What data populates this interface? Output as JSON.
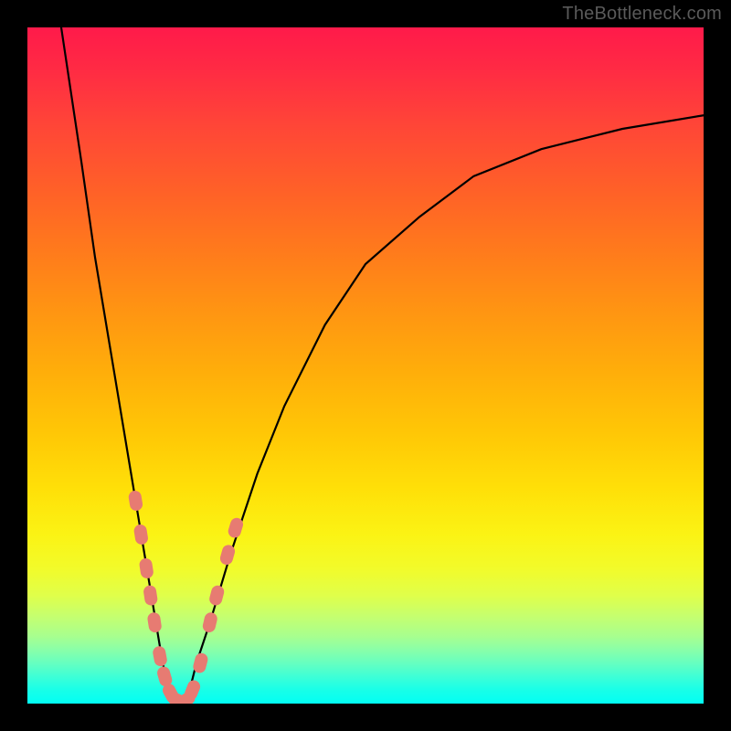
{
  "watermark": "TheBottleneck.com",
  "colors": {
    "frame": "#000000",
    "curve": "#000000",
    "marker": "#e77b72",
    "gradient_top": "#ff1a4a",
    "gradient_bottom": "#02fff4"
  },
  "chart_data": {
    "type": "line",
    "title": "",
    "xlabel": "",
    "ylabel": "",
    "xlim": [
      0,
      100
    ],
    "ylim": [
      0,
      100
    ],
    "grid": false,
    "legend": false,
    "series": [
      {
        "name": "bottleneck-curve",
        "x": [
          5,
          8,
          10,
          12,
          14,
          16,
          17,
          18,
          19,
          20,
          21,
          22,
          23,
          24,
          25,
          27,
          30,
          34,
          38,
          44,
          50,
          58,
          66,
          76,
          88,
          100
        ],
        "y": [
          100,
          80,
          66,
          54,
          42,
          30,
          24,
          18,
          12,
          6,
          2,
          0,
          0,
          2,
          6,
          12,
          22,
          34,
          44,
          56,
          65,
          72,
          78,
          82,
          85,
          87
        ]
      }
    ],
    "markers": {
      "name": "highlighted-points",
      "points": [
        {
          "x": 16.0,
          "y": 30
        },
        {
          "x": 16.8,
          "y": 25
        },
        {
          "x": 17.6,
          "y": 20
        },
        {
          "x": 18.2,
          "y": 16
        },
        {
          "x": 18.8,
          "y": 12
        },
        {
          "x": 19.6,
          "y": 7
        },
        {
          "x": 20.3,
          "y": 4
        },
        {
          "x": 21.2,
          "y": 1.5
        },
        {
          "x": 22.2,
          "y": 0.5
        },
        {
          "x": 23.4,
          "y": 0.5
        },
        {
          "x": 24.4,
          "y": 2
        },
        {
          "x": 25.6,
          "y": 6
        },
        {
          "x": 27.0,
          "y": 12
        },
        {
          "x": 28.0,
          "y": 16
        },
        {
          "x": 29.6,
          "y": 22
        },
        {
          "x": 30.8,
          "y": 26
        }
      ]
    },
    "annotations": [
      {
        "text": "TheBottleneck.com",
        "pos": "top-right"
      }
    ]
  }
}
